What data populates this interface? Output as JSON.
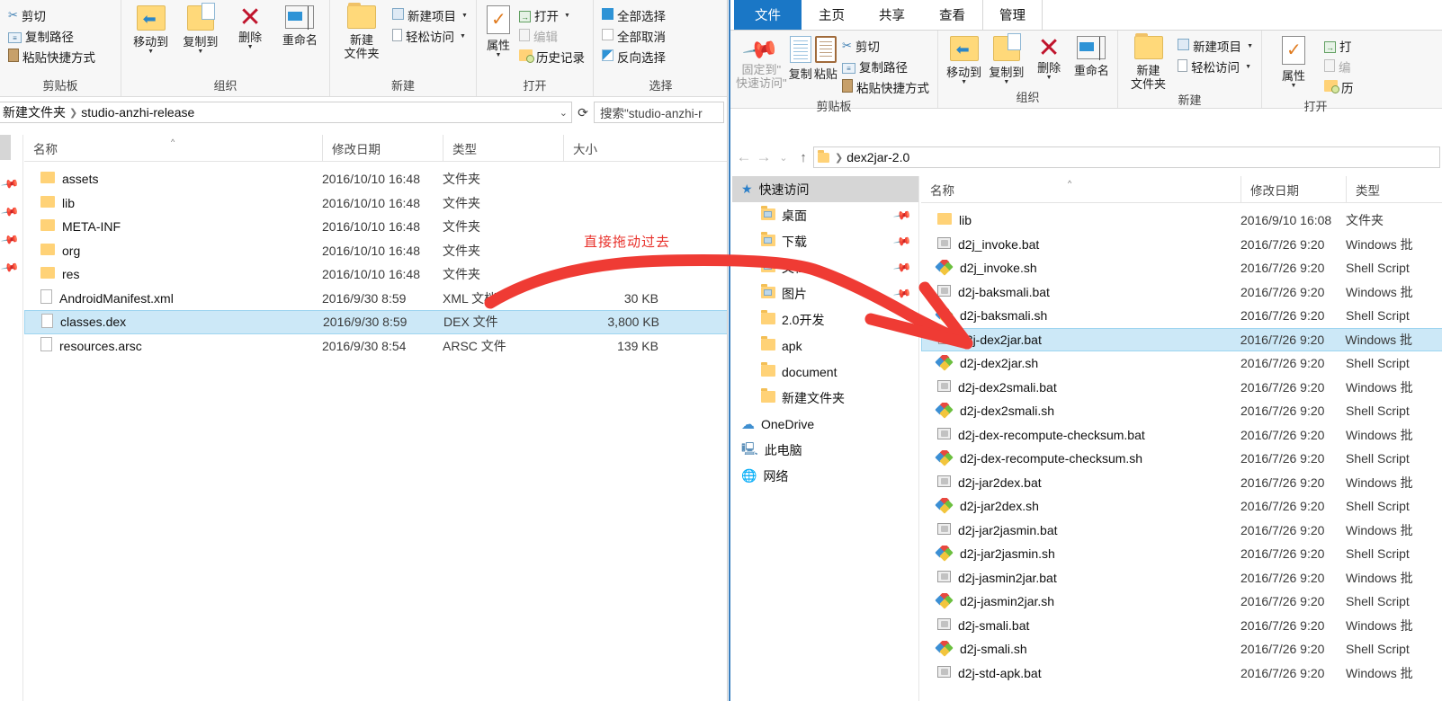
{
  "left_window": {
    "ribbon_groups": [
      {
        "title": "剪贴板",
        "small_buttons": [
          {
            "label": "剪切",
            "icon": "scissors-icon"
          },
          {
            "label": "复制路径",
            "icon": "copy-path-icon"
          },
          {
            "label": "粘贴快捷方式",
            "icon": "paste-shortcut-icon"
          }
        ]
      },
      {
        "title": "组织",
        "big_buttons": [
          {
            "label": "移动到",
            "icon": "move-to-icon",
            "caret": true
          },
          {
            "label": "复制到",
            "icon": "copy-to-icon",
            "caret": true
          },
          {
            "label": "删除",
            "icon": "delete-icon",
            "caret": true
          },
          {
            "label": "重命名",
            "icon": "rename-icon",
            "caret": false
          }
        ]
      },
      {
        "title": "新建",
        "big_buttons": [
          {
            "label": "新建\n文件夹",
            "icon": "new-folder-icon",
            "caret": false
          }
        ],
        "small_buttons": [
          {
            "label": "新建项目",
            "icon": "new-item-icon",
            "caret": true
          },
          {
            "label": "轻松访问",
            "icon": "easy-access-icon",
            "caret": true
          }
        ]
      },
      {
        "title": "打开",
        "big_buttons": [
          {
            "label": "属性",
            "icon": "properties-icon",
            "caret": true
          }
        ],
        "small_buttons": [
          {
            "label": "打开",
            "icon": "open-icon",
            "caret": true
          },
          {
            "label": "编辑",
            "icon": "edit-icon",
            "dim": true
          },
          {
            "label": "历史记录",
            "icon": "history-icon"
          }
        ]
      },
      {
        "title": "选择",
        "small_buttons": [
          {
            "label": "全部选择",
            "icon": "select-all-icon"
          },
          {
            "label": "全部取消",
            "icon": "select-none-icon"
          },
          {
            "label": "反向选择",
            "icon": "invert-selection-icon"
          }
        ]
      }
    ],
    "address": {
      "crumbs": [
        "新建文件夹",
        "studio-anzhi-release"
      ],
      "dropdown_icon": "chevron-down-icon",
      "refresh_icon": "refresh-icon"
    },
    "search_placeholder": "搜索\"studio-anzhi-r",
    "columns": [
      "名称",
      "修改日期",
      "类型",
      "大小"
    ],
    "sort_indicator": "^",
    "files": [
      {
        "name": "assets",
        "icon": "folder-icon",
        "date": "2016/10/10 16:48",
        "type": "文件夹",
        "size": ""
      },
      {
        "name": "lib",
        "icon": "folder-icon",
        "date": "2016/10/10 16:48",
        "type": "文件夹",
        "size": ""
      },
      {
        "name": "META-INF",
        "icon": "folder-icon",
        "date": "2016/10/10 16:48",
        "type": "文件夹",
        "size": ""
      },
      {
        "name": "org",
        "icon": "folder-icon",
        "date": "2016/10/10 16:48",
        "type": "文件夹",
        "size": ""
      },
      {
        "name": "res",
        "icon": "folder-icon",
        "date": "2016/10/10 16:48",
        "type": "文件夹",
        "size": ""
      },
      {
        "name": "AndroidManifest.xml",
        "icon": "file-icon",
        "date": "2016/9/30 8:59",
        "type": "XML 文档",
        "size": "30 KB"
      },
      {
        "name": "classes.dex",
        "icon": "file-icon",
        "date": "2016/9/30 8:59",
        "type": "DEX 文件",
        "size": "3,800 KB",
        "selected": true
      },
      {
        "name": "resources.arsc",
        "icon": "file-icon",
        "date": "2016/9/30 8:54",
        "type": "ARSC 文件",
        "size": "139 KB"
      }
    ]
  },
  "right_window": {
    "tabs": [
      {
        "label": "文件",
        "kind": "file"
      },
      {
        "label": "主页",
        "kind": "normal"
      },
      {
        "label": "共享",
        "kind": "normal"
      },
      {
        "label": "查看",
        "kind": "normal"
      },
      {
        "label": "管理",
        "kind": "active"
      }
    ],
    "ribbon_groups": [
      {
        "title": "剪贴板",
        "big_buttons": [
          {
            "label": "固定到\"\n快速访问\"",
            "icon": "pin-to-quick-access-icon",
            "dim": true
          },
          {
            "label": "复制",
            "icon": "copy-icon"
          },
          {
            "label": "粘贴",
            "icon": "paste-icon"
          }
        ],
        "small_buttons": [
          {
            "label": "剪切",
            "icon": "scissors-icon"
          },
          {
            "label": "复制路径",
            "icon": "copy-path-icon"
          },
          {
            "label": "粘贴快捷方式",
            "icon": "paste-shortcut-icon"
          }
        ]
      },
      {
        "title": "组织",
        "big_buttons": [
          {
            "label": "移动到",
            "icon": "move-to-icon",
            "caret": true
          },
          {
            "label": "复制到",
            "icon": "copy-to-icon",
            "caret": true
          },
          {
            "label": "删除",
            "icon": "delete-icon",
            "caret": true
          },
          {
            "label": "重命名",
            "icon": "rename-icon"
          }
        ]
      },
      {
        "title": "新建",
        "big_buttons": [
          {
            "label": "新建\n文件夹",
            "icon": "new-folder-icon"
          }
        ],
        "small_buttons": [
          {
            "label": "新建项目",
            "icon": "new-item-icon",
            "caret": true
          },
          {
            "label": "轻松访问",
            "icon": "easy-access-icon",
            "caret": true
          }
        ]
      },
      {
        "title": "打开",
        "big_buttons": [
          {
            "label": "属性",
            "icon": "properties-icon",
            "caret": true
          }
        ],
        "small_buttons": [
          {
            "label": "打",
            "icon": "open-icon"
          },
          {
            "label": "编",
            "icon": "edit-icon",
            "dim": true
          },
          {
            "label": "历",
            "icon": "history-icon"
          }
        ]
      }
    ],
    "address": {
      "crumbs": [
        "dex2jar-2.0"
      ],
      "back_icon": "arrow-left-icon",
      "forward_icon": "arrow-right-icon",
      "recent_icon": "chevron-down-icon",
      "up_icon": "arrow-up-icon"
    },
    "nav_pane": [
      {
        "label": "快速访问",
        "icon": "star-icon",
        "highlight": true,
        "indent": 0
      },
      {
        "label": "桌面",
        "icon": "desktop-folder-icon",
        "pin": true,
        "indent": 1
      },
      {
        "label": "下载",
        "icon": "downloads-folder-icon",
        "pin": true,
        "indent": 1
      },
      {
        "label": "文档",
        "icon": "documents-folder-icon",
        "pin": true,
        "indent": 1
      },
      {
        "label": "图片",
        "icon": "pictures-folder-icon",
        "pin": true,
        "indent": 1
      },
      {
        "label": "2.0开发",
        "icon": "folder-icon",
        "indent": 1
      },
      {
        "label": "apk",
        "icon": "folder-icon",
        "indent": 1
      },
      {
        "label": "document",
        "icon": "folder-icon",
        "indent": 1
      },
      {
        "label": "新建文件夹",
        "icon": "folder-icon",
        "indent": 1
      },
      {
        "label": "OneDrive",
        "icon": "onedrive-icon",
        "indent": 0
      },
      {
        "label": "此电脑",
        "icon": "this-pc-icon",
        "indent": 0
      },
      {
        "label": "网络",
        "icon": "network-icon",
        "indent": 0
      }
    ],
    "columns": [
      "名称",
      "修改日期",
      "类型"
    ],
    "sort_indicator": "^",
    "files": [
      {
        "name": "lib",
        "icon": "folder-icon",
        "date": "2016/9/10 16:08",
        "type": "文件夹"
      },
      {
        "name": "d2j_invoke.bat",
        "icon": "bat-icon",
        "date": "2016/7/26 9:20",
        "type": "Windows 批"
      },
      {
        "name": "d2j_invoke.sh",
        "icon": "sh-icon",
        "date": "2016/7/26 9:20",
        "type": "Shell Script"
      },
      {
        "name": "d2j-baksmali.bat",
        "icon": "bat-icon",
        "date": "2016/7/26 9:20",
        "type": "Windows 批"
      },
      {
        "name": "d2j-baksmali.sh",
        "icon": "sh-icon",
        "date": "2016/7/26 9:20",
        "type": "Shell Script"
      },
      {
        "name": "d2j-dex2jar.bat",
        "icon": "bat-icon",
        "date": "2016/7/26 9:20",
        "type": "Windows 批",
        "selected": true
      },
      {
        "name": "d2j-dex2jar.sh",
        "icon": "sh-icon",
        "date": "2016/7/26 9:20",
        "type": "Shell Script"
      },
      {
        "name": "d2j-dex2smali.bat",
        "icon": "bat-icon",
        "date": "2016/7/26 9:20",
        "type": "Windows 批"
      },
      {
        "name": "d2j-dex2smali.sh",
        "icon": "sh-icon",
        "date": "2016/7/26 9:20",
        "type": "Shell Script"
      },
      {
        "name": "d2j-dex-recompute-checksum.bat",
        "icon": "bat-icon",
        "date": "2016/7/26 9:20",
        "type": "Windows 批"
      },
      {
        "name": "d2j-dex-recompute-checksum.sh",
        "icon": "sh-icon",
        "date": "2016/7/26 9:20",
        "type": "Shell Script"
      },
      {
        "name": "d2j-jar2dex.bat",
        "icon": "bat-icon",
        "date": "2016/7/26 9:20",
        "type": "Windows 批"
      },
      {
        "name": "d2j-jar2dex.sh",
        "icon": "sh-icon",
        "date": "2016/7/26 9:20",
        "type": "Shell Script"
      },
      {
        "name": "d2j-jar2jasmin.bat",
        "icon": "bat-icon",
        "date": "2016/7/26 9:20",
        "type": "Windows 批"
      },
      {
        "name": "d2j-jar2jasmin.sh",
        "icon": "sh-icon",
        "date": "2016/7/26 9:20",
        "type": "Shell Script"
      },
      {
        "name": "d2j-jasmin2jar.bat",
        "icon": "bat-icon",
        "date": "2016/7/26 9:20",
        "type": "Windows 批"
      },
      {
        "name": "d2j-jasmin2jar.sh",
        "icon": "sh-icon",
        "date": "2016/7/26 9:20",
        "type": "Shell Script"
      },
      {
        "name": "d2j-smali.bat",
        "icon": "bat-icon",
        "date": "2016/7/26 9:20",
        "type": "Windows 批"
      },
      {
        "name": "d2j-smali.sh",
        "icon": "sh-icon",
        "date": "2016/7/26 9:20",
        "type": "Shell Script"
      },
      {
        "name": "d2j-std-apk.bat",
        "icon": "bat-icon",
        "date": "2016/7/26 9:20",
        "type": "Windows 批"
      }
    ]
  },
  "annotation": {
    "text": "直接拖动过去",
    "color": "#ee2b26"
  }
}
